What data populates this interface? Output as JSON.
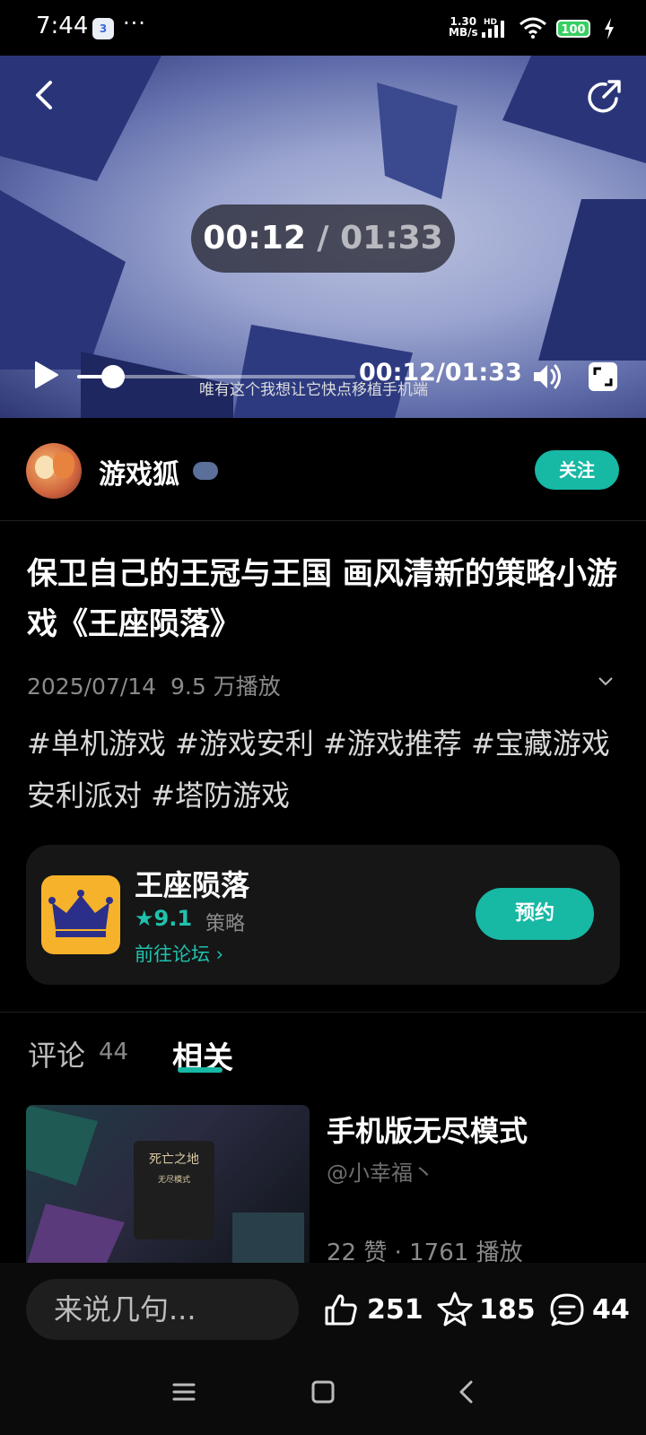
{
  "status_bar": {
    "time": "7:44",
    "app_badge": "3",
    "more": "···",
    "speed_value": "1.30",
    "speed_unit": "MB/s",
    "hd": "HD",
    "battery": "100"
  },
  "video": {
    "current_time": "00:12",
    "separator": " / ",
    "total_time": "01:33",
    "time_display": "00:12/01:33",
    "subtitle": "唯有这个我想让它快点移植手机端",
    "progress_fraction": 0.129
  },
  "author": {
    "name": "游戏狐",
    "follow_label": "关注"
  },
  "post": {
    "title": "保卫自己的王冠与王国 画风清新的策略小游戏《王座陨落》",
    "date": "2025/07/14",
    "views": "9.5 万播放",
    "tags": "#单机游戏 #游戏安利 #游戏推荐 #宝藏游戏安利派对 #塔防游戏"
  },
  "game": {
    "name": "王座陨落",
    "rating": "9.1",
    "genre": "策略",
    "forum_link": "前往论坛",
    "reserve_label": "预约"
  },
  "tabs": {
    "comments_label": "评论",
    "comments_count": "44",
    "related_label": "相关"
  },
  "related": {
    "title": "手机版无尽模式",
    "author": "@小幸福丶",
    "stats": "22 赞 · 1761 播放",
    "thumb_title": "死亡之地",
    "thumb_sub": "无尽模式"
  },
  "bottom": {
    "comment_placeholder": "来说几句...",
    "likes": "251",
    "favorites": "185",
    "comments": "44"
  },
  "colors": {
    "accent": "#17b8a4",
    "background": "#000000",
    "card": "#161616"
  }
}
